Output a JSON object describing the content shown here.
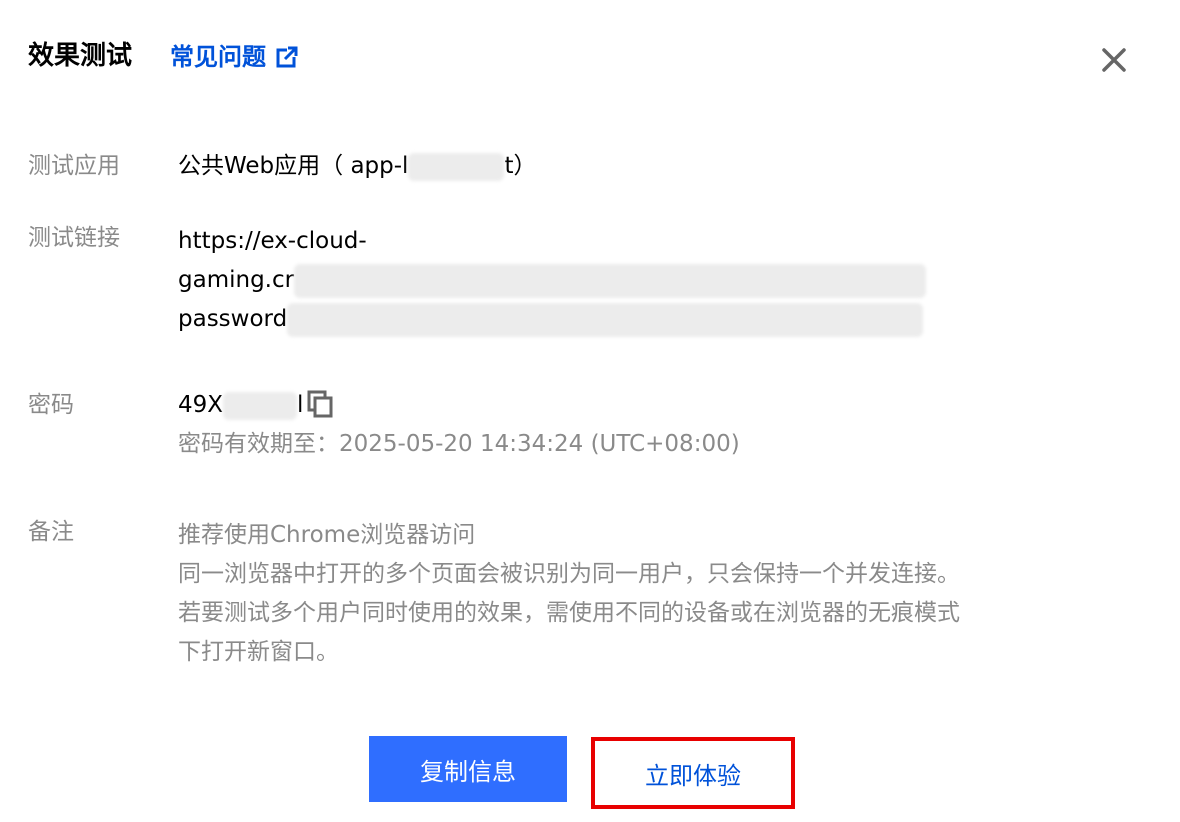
{
  "header": {
    "title": "效果测试",
    "faq_link": "常见问题",
    "faq_icon": "external-link-icon",
    "close_icon": "close-icon",
    "link_color": "#0052d9"
  },
  "test_app": {
    "label": "测试应用",
    "value_prefix": "公共Web应用（ app-l",
    "value_suffix": "t）"
  },
  "test_link": {
    "label": "测试链接",
    "line1": "https://ex-cloud-",
    "line2_visible": "gaming.cr",
    "line3_visible": "password"
  },
  "password": {
    "label": "密码",
    "value_prefix": "49X",
    "value_suffix": "l",
    "copy_icon": "copy-icon",
    "expire_text": "密码有效期至：2025-05-20 14:34:24 (UTC+08:00)"
  },
  "notes": {
    "label": "备注",
    "lines": [
      "推荐使用Chrome浏览器访问",
      "同一浏览器中打开的多个页面会被识别为同一用户，只会保持一个并发连接。",
      "若要测试多个用户同时使用的效果，需使用不同的设备或在浏览器的无痕模式",
      "下打开新窗口。"
    ]
  },
  "buttons": {
    "copy_info": "复制信息",
    "try_now": "立即体验",
    "primary_color": "#2f6eff",
    "highlight_border_color": "#e80000"
  }
}
